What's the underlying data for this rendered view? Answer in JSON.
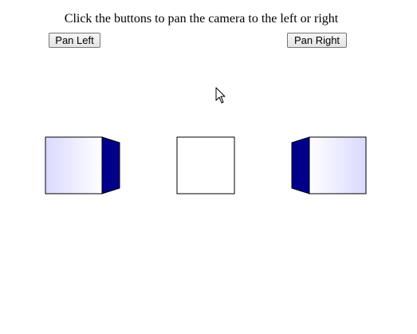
{
  "instruction": "Click the buttons to pan the camera to the left or right",
  "buttons": {
    "pan_left": "Pan Left",
    "pan_right": "Pan Right"
  },
  "scene": {
    "cube_face_gradient": [
      "#d9d9ff",
      "#ffffff"
    ],
    "cube_side_color": "#00008b",
    "cube_outline_color": "#000000"
  },
  "cursor_icon": "arrow-cursor-icon"
}
